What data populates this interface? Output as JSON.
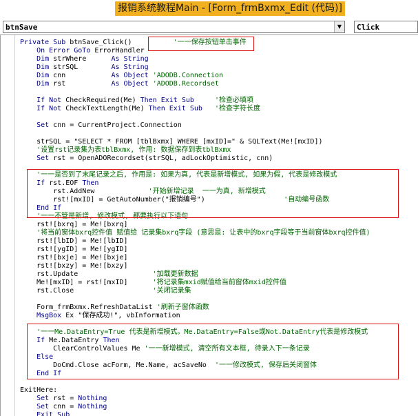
{
  "window": {
    "title": "报销系统教程Main - [Form_frmBxmx_Edit (代码)]"
  },
  "object_combo": {
    "value": "btnSave"
  },
  "procedure_combo": {
    "value": "Click"
  },
  "code_lines": [
    [
      {
        "t": "Private Sub ",
        "c": "kw"
      },
      {
        "t": "btnSave_Click()",
        "c": "tx"
      },
      {
        "t": "          '一一保存按钮单击事件",
        "c": "cm"
      }
    ],
    [
      {
        "t": "    On Error GoTo ",
        "c": "kw"
      },
      {
        "t": "ErrorHandler",
        "c": "tx"
      }
    ],
    [
      {
        "t": "    Dim ",
        "c": "kw"
      },
      {
        "t": "strWhere      ",
        "c": "tx"
      },
      {
        "t": "As String",
        "c": "kw"
      }
    ],
    [
      {
        "t": "    Dim ",
        "c": "kw"
      },
      {
        "t": "strSQL        ",
        "c": "tx"
      },
      {
        "t": "As String",
        "c": "kw"
      }
    ],
    [
      {
        "t": "    Dim ",
        "c": "kw"
      },
      {
        "t": "cnn           ",
        "c": "tx"
      },
      {
        "t": "As Object ",
        "c": "kw"
      },
      {
        "t": "'ADODB.Connection",
        "c": "cm"
      }
    ],
    [
      {
        "t": "    Dim ",
        "c": "kw"
      },
      {
        "t": "rst           ",
        "c": "tx"
      },
      {
        "t": "As Object ",
        "c": "kw"
      },
      {
        "t": "'ADODB.Recordset",
        "c": "cm"
      }
    ],
    [],
    [
      {
        "t": "    If Not ",
        "c": "kw"
      },
      {
        "t": "CheckRequired(Me) ",
        "c": "tx"
      },
      {
        "t": "Then Exit Sub",
        "c": "kw"
      },
      {
        "t": "     '检查必填项",
        "c": "cm"
      }
    ],
    [
      {
        "t": "    If Not ",
        "c": "kw"
      },
      {
        "t": "CheckTextLength(Me) ",
        "c": "tx"
      },
      {
        "t": "Then Exit Sub",
        "c": "kw"
      },
      {
        "t": "   '检查字符长度",
        "c": "cm"
      }
    ],
    [],
    [
      {
        "t": "    Set ",
        "c": "kw"
      },
      {
        "t": "cnn = CurrentProject.Connection",
        "c": "tx"
      }
    ],
    [],
    [
      {
        "t": "    strSQL = \"SELECT * FROM [tblBxmx] WHERE [mxID]=\" & SQLText(Me![mxID])",
        "c": "tx"
      }
    ],
    [
      {
        "t": "    '设置rst记录集为表tblBxmx, 作用: 数据保存到表tblBxmx",
        "c": "cm"
      }
    ],
    [
      {
        "t": "    Set ",
        "c": "kw"
      },
      {
        "t": "rst = OpenADORecordset(strSQL, adLockOptimistic, cnn)",
        "c": "tx"
      }
    ],
    [],
    [
      {
        "t": "    '一一是否到了末尾记录之后, 作用是: 如果为真, 代表是新增模式, 如果为假, 代表是修改模式",
        "c": "cm"
      }
    ],
    [
      {
        "t": "    If ",
        "c": "kw"
      },
      {
        "t": "rst.EOF ",
        "c": "tx"
      },
      {
        "t": "Then",
        "c": "kw"
      }
    ],
    [
      {
        "t": "        rst.AddNew             ",
        "c": "tx"
      },
      {
        "t": "'开始新增记录  一一为真, 新增模式",
        "c": "cm"
      }
    ],
    [
      {
        "t": "        rst![mxID] = GetAutoNumber(\"报销编号\")                   ",
        "c": "tx"
      },
      {
        "t": "'自动编号函数",
        "c": "cm"
      }
    ],
    [
      {
        "t": "    End If",
        "c": "kw"
      }
    ],
    [
      {
        "t": "    '一一不管是新增, 修改模式, 都要执行以下语句",
        "c": "cm"
      }
    ],
    [
      {
        "t": "    rst![bxrq] = Me![bxrq]",
        "c": "tx"
      }
    ],
    [
      {
        "t": "    '将当前窗体bxrq控件值 赋值给 记录集bxrq字段 (意思是: 让表中的bxrq字段等于当前窗体bxrq控件值)",
        "c": "cm"
      }
    ],
    [
      {
        "t": "    rst![lbID] = Me![lbID]",
        "c": "tx"
      }
    ],
    [
      {
        "t": "    rst![ygID] = Me![ygID]",
        "c": "tx"
      }
    ],
    [
      {
        "t": "    rst![bxje] = Me![bxje]",
        "c": "tx"
      }
    ],
    [
      {
        "t": "    rst![bxzy] = Me![bxzy]",
        "c": "tx"
      }
    ],
    [
      {
        "t": "    rst.Update                  ",
        "c": "tx"
      },
      {
        "t": "'加载更新数据",
        "c": "cm"
      }
    ],
    [
      {
        "t": "    Me![mxID] = rst![mxID]      ",
        "c": "tx"
      },
      {
        "t": "'将记录集mxid赋值给当前窗体mxid控件值",
        "c": "cm"
      }
    ],
    [
      {
        "t": "    rst.Close                   ",
        "c": "tx"
      },
      {
        "t": "'关闭记录集",
        "c": "cm"
      }
    ],
    [],
    [
      {
        "t": "    Form_frmBxmx.RefreshDataList ",
        "c": "tx"
      },
      {
        "t": "'刷新子窗体函数",
        "c": "cm"
      }
    ],
    [
      {
        "t": "    MsgBox ",
        "c": "kw"
      },
      {
        "t": "Ex \"保存成功!\", vbInformation",
        "c": "tx"
      }
    ],
    [],
    [
      {
        "t": "    '一一Me.DataEntry=True 代表是新增模式。Me.DataEntry=False或Not.DataEntry代表是修改模式",
        "c": "cm"
      }
    ],
    [
      {
        "t": "    If ",
        "c": "kw"
      },
      {
        "t": "Me.DataEntry ",
        "c": "tx"
      },
      {
        "t": "Then",
        "c": "kw"
      }
    ],
    [
      {
        "t": "        ClearControlValues Me ",
        "c": "tx"
      },
      {
        "t": "'一一新增模式, 清空所有文本框, 待录入下一条记录",
        "c": "cm"
      }
    ],
    [
      {
        "t": "    Else",
        "c": "kw"
      }
    ],
    [
      {
        "t": "        DoCmd.Close acForm, Me.Name, acSaveNo  ",
        "c": "tx"
      },
      {
        "t": "'一一修改模式, 保存后关闭窗体",
        "c": "cm"
      }
    ],
    [
      {
        "t": "    End If",
        "c": "kw"
      }
    ],
    [],
    [
      {
        "t": "ExitHere:",
        "c": "tx"
      }
    ],
    [
      {
        "t": "    Set ",
        "c": "kw"
      },
      {
        "t": "rst = ",
        "c": "tx"
      },
      {
        "t": "Nothing",
        "c": "kw"
      }
    ],
    [
      {
        "t": "    Set ",
        "c": "kw"
      },
      {
        "t": "cnn = ",
        "c": "tx"
      },
      {
        "t": "Nothing",
        "c": "kw"
      }
    ],
    [
      {
        "t": "    Exit Sub",
        "c": "kw"
      }
    ]
  ]
}
